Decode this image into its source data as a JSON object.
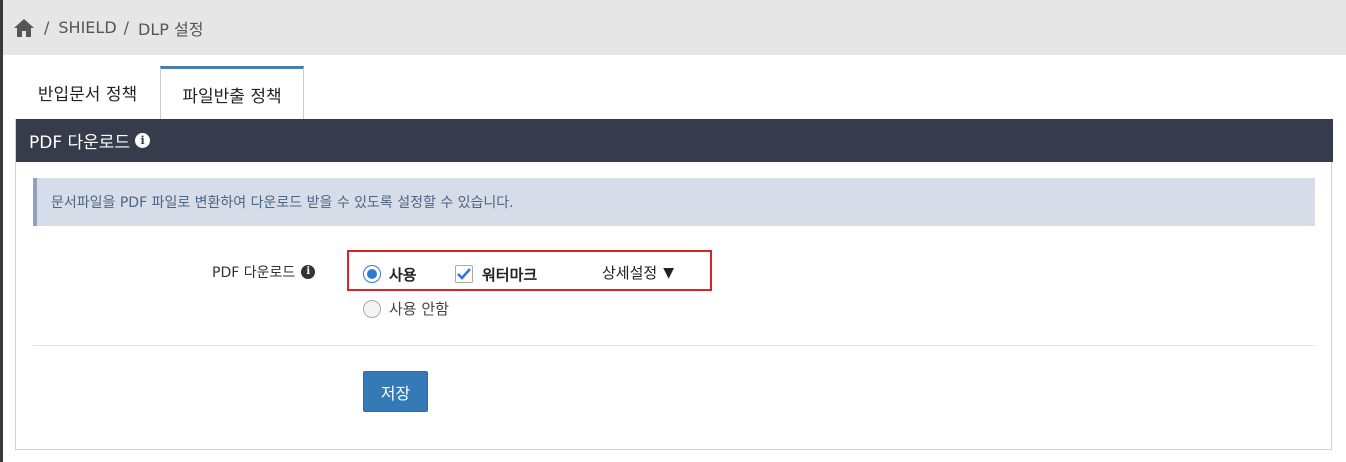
{
  "breadcrumb": {
    "home_icon": "home-icon",
    "items": [
      "SHIELD",
      "DLP 설정"
    ],
    "separator": "/"
  },
  "tabs": [
    {
      "label": "반입문서 정책",
      "active": false
    },
    {
      "label": "파일반출 정책",
      "active": true
    }
  ],
  "panel": {
    "title": "PDF 다운로드",
    "info_icon": "info-icon",
    "notice": "문서파일을 PDF 파일로 변환하여 다운로드 받을 수 있도록 설정할 수 있습니다.",
    "field_label": "PDF 다운로드",
    "options": {
      "use_label": "사용",
      "use_checked": true,
      "watermark_label": "워터마크",
      "watermark_checked": true,
      "detail_label": "상세설정",
      "detail_caret": "▼",
      "not_use_label": "사용 안함",
      "not_use_checked": false
    },
    "save_label": "저장"
  },
  "colors": {
    "panel_header": "#363c4b",
    "notice_bg": "#d7dde8",
    "accent": "#337ab7",
    "highlight": "#d9232a"
  }
}
